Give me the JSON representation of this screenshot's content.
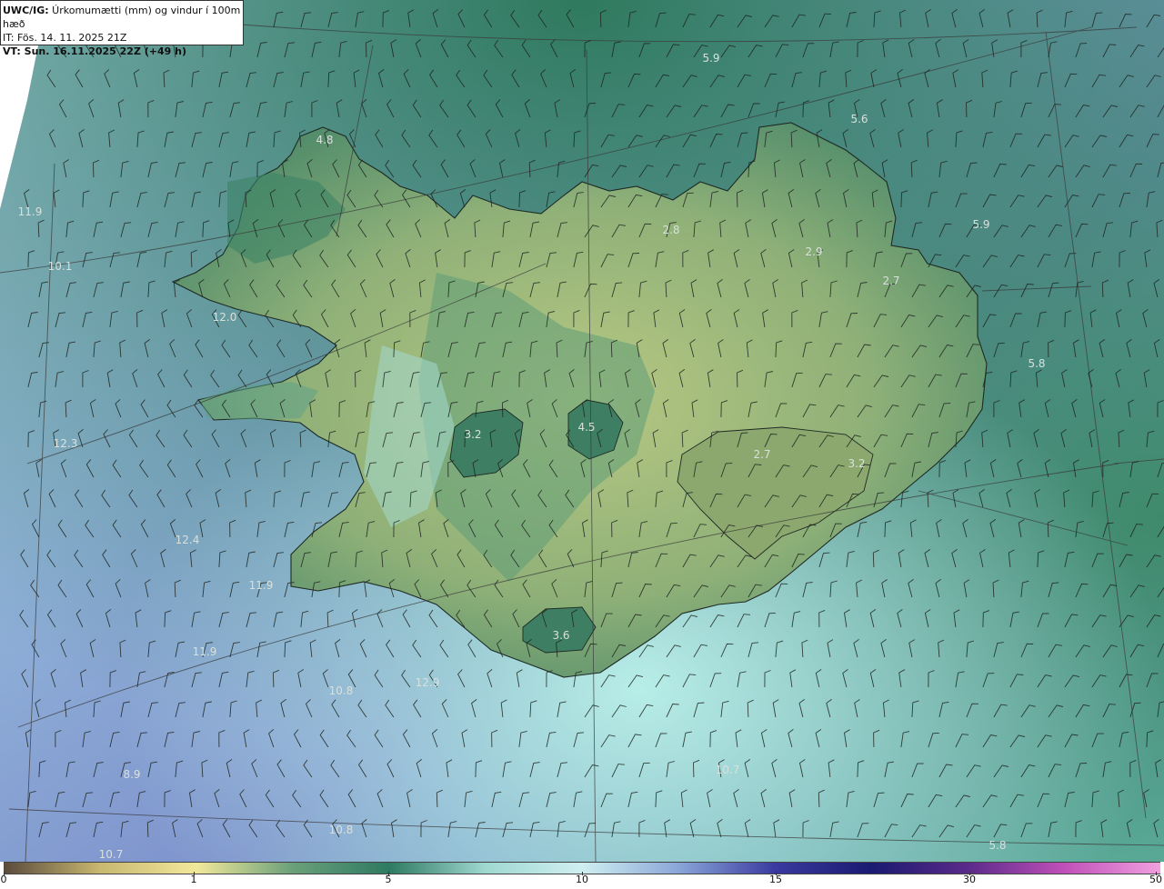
{
  "header": {
    "line1_bold": "UWC/IG:",
    "line1_rest": " Úrkomumætti (mm) og vindur í 100m hæð",
    "line2": "IT: Fös. 14. 11. 2025 21Z",
    "line3": "VT: Sun. 16.11.2025 22Z (+49 h)"
  },
  "map_values": [
    {
      "text": "5.9"
    },
    {
      "text": "5.6"
    },
    {
      "text": "4.8"
    },
    {
      "text": "11.9"
    },
    {
      "text": "10.1"
    },
    {
      "text": "2.8"
    },
    {
      "text": "2.9"
    },
    {
      "text": "5.9"
    },
    {
      "text": "2.7"
    },
    {
      "text": "12.0"
    },
    {
      "text": "5.8"
    },
    {
      "text": "4.5"
    },
    {
      "text": "3.2"
    },
    {
      "text": "2.7"
    },
    {
      "text": "12.3"
    },
    {
      "text": "3.2"
    },
    {
      "text": "12.4"
    },
    {
      "text": "11.9"
    },
    {
      "text": "3.6"
    },
    {
      "text": "11.9"
    },
    {
      "text": "12.9"
    },
    {
      "text": "10.8"
    },
    {
      "text": "8.9"
    },
    {
      "text": "10.7"
    },
    {
      "text": "10.8"
    },
    {
      "text": "5.8"
    },
    {
      "text": "10.7"
    }
  ],
  "colorbar": {
    "ticks": [
      {
        "label": "0",
        "value": 0
      },
      {
        "label": "1",
        "value": 1
      },
      {
        "label": "5",
        "value": 5
      },
      {
        "label": "10",
        "value": 10
      },
      {
        "label": "15",
        "value": 15
      },
      {
        "label": "30",
        "value": 30
      },
      {
        "label": "50",
        "value": 50
      }
    ],
    "colors": [
      "#5a4a3c",
      "#c8b870",
      "#f2e89a",
      "#6aa07a",
      "#2e7a62",
      "#9fd8d0",
      "#cfeff0",
      "#8aa6d8",
      "#3a3aa0",
      "#1a1a70",
      "#5a2a8a",
      "#c050b8",
      "#f0a0e0"
    ]
  }
}
